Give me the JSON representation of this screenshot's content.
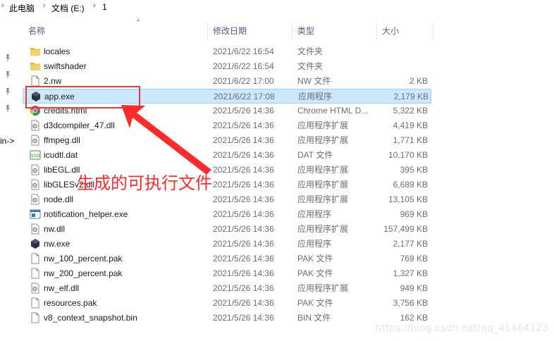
{
  "breadcrumb": {
    "items": [
      "此电脑",
      "文档 (E:)",
      "1"
    ],
    "separator": "›"
  },
  "left_pane": {
    "partial_text": "in->"
  },
  "columns": {
    "name": "名称",
    "date": "修改日期",
    "type": "类型",
    "size": "大小"
  },
  "files": [
    {
      "name": "locales",
      "date": "2021/6/22 16:54",
      "type": "文件夹",
      "size": "",
      "icon": "folder-icon"
    },
    {
      "name": "swiftshader",
      "date": "2021/6/22 16:54",
      "type": "文件夹",
      "size": "",
      "icon": "folder-icon"
    },
    {
      "name": "2.nw",
      "date": "2021/6/22 17:00",
      "type": "NW 文件",
      "size": "2 KB",
      "icon": "file-icon"
    },
    {
      "name": "app.exe",
      "date": "2021/6/22 17:08",
      "type": "应用程序",
      "size": "2,179 KB",
      "icon": "nw-app-icon",
      "selected": true
    },
    {
      "name": "credits.html",
      "date": "2021/5/26 14:36",
      "type": "Chrome HTML D...",
      "size": "5,322 KB",
      "icon": "chrome-icon"
    },
    {
      "name": "d3dcompiler_47.dll",
      "date": "2021/5/26 14:36",
      "type": "应用程序扩展",
      "size": "4,419 KB",
      "icon": "dll-icon"
    },
    {
      "name": "ffmpeg.dll",
      "date": "2021/5/26 14:36",
      "type": "应用程序扩展",
      "size": "1,771 KB",
      "icon": "dll-icon"
    },
    {
      "name": "icudtl.dat",
      "date": "2021/5/26 14:36",
      "type": "DAT 文件",
      "size": "10,170 KB",
      "icon": "dat-icon"
    },
    {
      "name": "libEGL.dll",
      "date": "2021/5/26 14:36",
      "type": "应用程序扩展",
      "size": "395 KB",
      "icon": "dll-icon"
    },
    {
      "name": "libGLESv2.dll",
      "date": "2021/5/26 14:36",
      "type": "应用程序扩展",
      "size": "6,689 KB",
      "icon": "dll-icon"
    },
    {
      "name": "node.dll",
      "date": "2021/5/26 14:36",
      "type": "应用程序扩展",
      "size": "13,105 KB",
      "icon": "dll-icon"
    },
    {
      "name": "notification_helper.exe",
      "date": "2021/5/26 14:36",
      "type": "应用程序",
      "size": "969 KB",
      "icon": "exe-window-icon"
    },
    {
      "name": "nw.dll",
      "date": "2021/5/26 14:36",
      "type": "应用程序扩展",
      "size": "157,499 KB",
      "icon": "dll-icon"
    },
    {
      "name": "nw.exe",
      "date": "2021/5/26 14:36",
      "type": "应用程序",
      "size": "2,177 KB",
      "icon": "nw-app-icon"
    },
    {
      "name": "nw_100_percent.pak",
      "date": "2021/5/26 14:36",
      "type": "PAK 文件",
      "size": "769 KB",
      "icon": "file-icon"
    },
    {
      "name": "nw_200_percent.pak",
      "date": "2021/5/26 14:36",
      "type": "PAK 文件",
      "size": "1,327 KB",
      "icon": "file-icon"
    },
    {
      "name": "nw_elf.dll",
      "date": "2021/5/26 14:36",
      "type": "应用程序扩展",
      "size": "949 KB",
      "icon": "dll-icon"
    },
    {
      "name": "resources.pak",
      "date": "2021/5/26 14:36",
      "type": "PAK 文件",
      "size": "3,756 KB",
      "icon": "file-icon"
    },
    {
      "name": "v8_context_snapshot.bin",
      "date": "2021/5/26 14:36",
      "type": "BIN 文件",
      "size": "162 KB",
      "icon": "file-icon"
    }
  ],
  "annotation": {
    "text": "生成的可执行文件",
    "color": "#ff2a2a"
  },
  "watermark": "https://blog.csdn.net/qq_41464123",
  "colors": {
    "selection_bg": "#cce8ff",
    "selection_border": "#99d1ff",
    "folder": "#f5c542",
    "header_text": "#4d6082"
  }
}
